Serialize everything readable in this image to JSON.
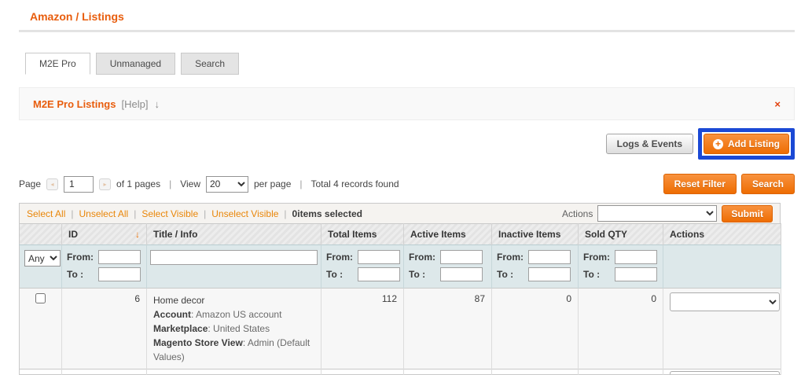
{
  "breadcrumb": {
    "title": "Amazon / Listings"
  },
  "tabs": {
    "m2e_pro": "M2E Pro",
    "unmanaged": "Unmanaged",
    "search": "Search"
  },
  "panel": {
    "title": "M2E Pro Listings",
    "help": "[Help]",
    "collapse_icon": "↓",
    "close_icon": "×"
  },
  "toolbar": {
    "logs_events": "Logs & Events",
    "add_listing": "Add Listing",
    "plus_icon": "+"
  },
  "pager": {
    "page_label": "Page",
    "prev_icon": "◂",
    "next_icon": "▸",
    "page_value": "1",
    "of_pages": "of 1 pages",
    "separator": "|",
    "view_label": "View",
    "per_page_value": "20",
    "per_page_label": "per page",
    "total_text": "Total 4 records found",
    "reset_filter": "Reset Filter",
    "search": "Search"
  },
  "massaction": {
    "select_all": "Select All",
    "unselect_all": "Unselect All",
    "select_visible": "Select Visible",
    "unselect_visible": "Unselect Visible",
    "separator": "|",
    "selected_count": "0",
    "selected_suffix": " items selected",
    "actions_label": "Actions",
    "submit": "Submit"
  },
  "grid": {
    "headers": {
      "id": "ID",
      "title_info": "Title / Info",
      "total_items": "Total Items",
      "active_items": "Active Items",
      "inactive_items": "Inactive Items",
      "sold_qty": "Sold QTY",
      "actions": "Actions"
    },
    "sort_icon": "↓",
    "filter": {
      "any": "Any",
      "from_label": "From:",
      "to_label": "To :"
    },
    "colon": ": ",
    "rows": [
      {
        "id": "6",
        "title": "Home decor",
        "account_label": "Account",
        "account": "Amazon US account",
        "marketplace_label": "Marketplace",
        "marketplace": "United States",
        "store_view_label": "Magento Store View",
        "store_view": "Admin (Default Values)",
        "total_items": "112",
        "active_items": "87",
        "inactive_items": "0",
        "sold_qty": "0"
      }
    ]
  },
  "colors": {
    "accent_orange": "#e85d0d",
    "button_orange": "#ee6d02",
    "link_orange": "#e98609",
    "negative_red": "#eb2020",
    "annotation_blue": "#1b49d5",
    "filter_row_bg": "#dde8ea"
  }
}
